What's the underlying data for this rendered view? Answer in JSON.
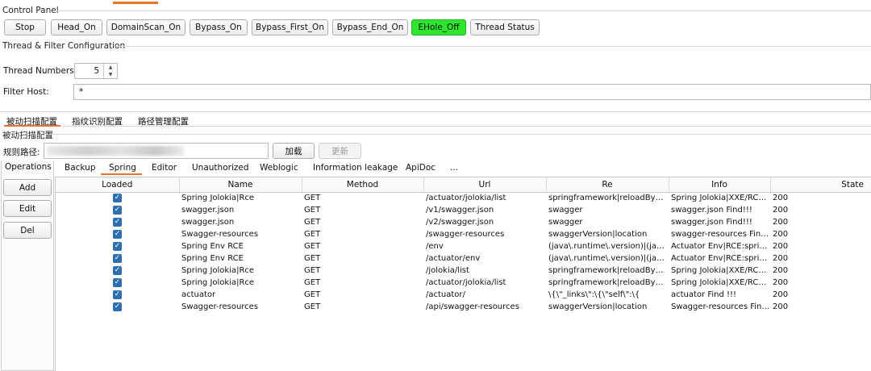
{
  "control_panel": {
    "title": "Control Panel",
    "buttons": {
      "stop": "Stop",
      "head_on": "Head_On",
      "domainscan_on": "DomainScan_On",
      "bypass_on": "Bypass_On",
      "bypass_first_on": "Bypass_First_On",
      "bypass_end_on": "Bypass_End_On",
      "ehole_off": "EHole_Off",
      "thread_status": "Thread Status"
    },
    "active_color": "#2ee62e"
  },
  "thread_filter": {
    "title": "Thread & Filter Configuration",
    "thread_label": "Thread Numbers:",
    "thread_value": "5",
    "filter_label": "Filter Host:",
    "filter_value": "*"
  },
  "main_tabs": [
    "被动扫描配置",
    "指纹识别配置",
    "路径管理配置"
  ],
  "passive_scan": {
    "section_title": "被动扫描配置",
    "rule_path_label": "规则路径:",
    "load_button": "加载",
    "update_button": "更新"
  },
  "operations": {
    "title": "Operations",
    "add": "Add",
    "edit": "Edit",
    "del": "Del"
  },
  "sub_tabs": [
    "Backup",
    "Spring",
    "Editor",
    "Unauthorized",
    "Weblogic",
    "Information leakage",
    "ApiDoc",
    "..."
  ],
  "accent_color": "#e8732c",
  "table": {
    "columns": [
      "Loaded",
      "Name",
      "Method",
      "Url",
      "Re",
      "Info",
      "State"
    ],
    "rows": [
      {
        "loaded": true,
        "name": "Spring Jolokia|Rce",
        "method": "GET",
        "url": "/actuator/jolokia/list",
        "re": "springframework|reloadByURL...",
        "info": "Spring Jolokia|XXE/RCE:reload...",
        "state": "200"
      },
      {
        "loaded": true,
        "name": "swagger.json",
        "method": "GET",
        "url": "/v1/swagger.json",
        "re": "swagger",
        "info": "swagger.json Find!!!",
        "state": "200"
      },
      {
        "loaded": true,
        "name": "swagger.json",
        "method": "GET",
        "url": "/v2/swagger.json",
        "re": "swagger",
        "info": "swagger.json Find!!!",
        "state": "200"
      },
      {
        "loaded": true,
        "name": "Swagger-resources",
        "method": "GET",
        "url": "/swagger-resources",
        "re": "swaggerVersion|location",
        "info": "swagger-resources Find!!!",
        "state": "200"
      },
      {
        "loaded": true,
        "name": "Spring Env RCE",
        "method": "GET",
        "url": "/env",
        "re": "(java\\.runtime\\.version)|(java\\.c...",
        "info": "Actuator Env|RCE:spring.cloud...",
        "state": "200"
      },
      {
        "loaded": true,
        "name": "Spring Env RCE",
        "method": "GET",
        "url": "/actuator/env",
        "re": "(java\\.runtime\\.version)|(java\\.c...",
        "info": "Actuator Env|RCE:spring.cloud...",
        "state": "200"
      },
      {
        "loaded": true,
        "name": "Spring Jolokia|Rce",
        "method": "GET",
        "url": "/jolokia/list",
        "re": "springframework|reloadByURL...",
        "info": "Spring Jolokia|XXE/RCE:reload...",
        "state": "200"
      },
      {
        "loaded": true,
        "name": "Spring Jolokia|Rce",
        "method": "GET",
        "url": "/actuator/jolokia/list",
        "re": "springframework|reloadByURL...",
        "info": "Spring Jolokia|XXE/RCE:reload...",
        "state": "200"
      },
      {
        "loaded": true,
        "name": "actuator",
        "method": "GET",
        "url": "/actuator/",
        "re": "\\{\\\"_links\\\":\\{\\\"self\\\":\\{",
        "info": "actuator Find !!!",
        "state": "200"
      },
      {
        "loaded": true,
        "name": "Swagger-resources",
        "method": "GET",
        "url": "/api/swagger-resources",
        "re": "swaggerVersion|location",
        "info": "Swagger-resources Find!!!",
        "state": "200"
      }
    ]
  }
}
